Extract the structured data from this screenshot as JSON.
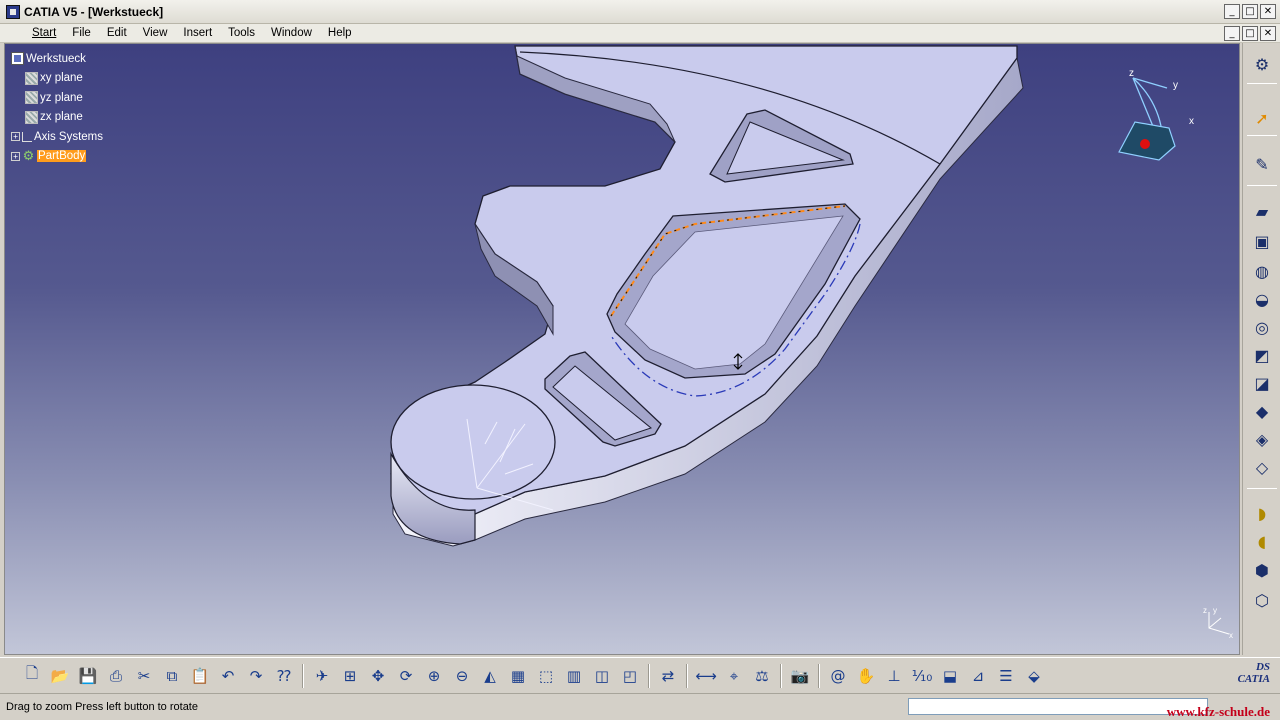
{
  "window": {
    "title": "CATIA V5 - [Werkstueck]",
    "controls": [
      "_",
      "□",
      "✕"
    ]
  },
  "menu": {
    "items": [
      "Start",
      "File",
      "Edit",
      "View",
      "Insert",
      "Tools",
      "Window",
      "Help"
    ]
  },
  "tree": {
    "root": "Werkstueck",
    "xy": "xy plane",
    "yz": "yz plane",
    "zx": "zx plane",
    "axis": "Axis Systems",
    "body": "PartBody"
  },
  "compass": {
    "x": "x",
    "y": "y",
    "z": "z"
  },
  "status": {
    "message": "Drag to zoom  Press left button to rotate"
  },
  "watermark": "www.kfz-schule.de",
  "logo": {
    "brand": "CATIA",
    "mark": "DS"
  },
  "colors": {
    "selection": "#ff9c1c",
    "viewport_top": "#3e4080",
    "viewport_bottom": "#c2c6d8",
    "part_face": "#c9cbed"
  }
}
